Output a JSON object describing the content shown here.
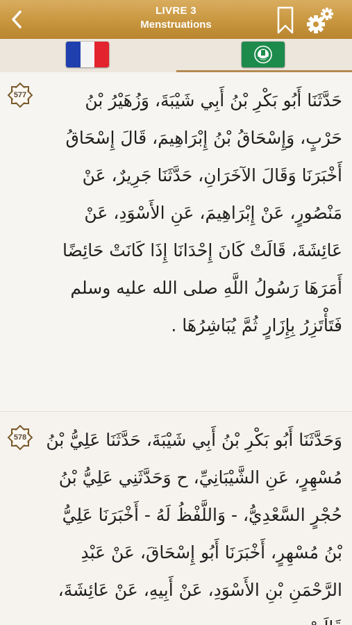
{
  "header": {
    "book": "LIVRE 3",
    "chapter": "Menstruations",
    "icons": {
      "back": "chevron-left-icon",
      "bookmark": "bookmark-icon",
      "settings": "gear-icon"
    }
  },
  "languages": {
    "tabs": [
      {
        "name": "french",
        "flag": "france-flag-icon",
        "active": false
      },
      {
        "name": "arabic",
        "flag": "arab-league-flag-icon",
        "active": true
      }
    ]
  },
  "colors": {
    "header_gold": "#c8963f",
    "tab_underline": "#b58a52",
    "badge_border": "#7a5a2c"
  },
  "hadiths": [
    {
      "number": "577",
      "text": "حَدَّثَنَا أَبُو بَكْرِ بْنُ أَبِي شَيْبَةَ، وَزُهَيْرُ بْنُ حَرْبٍ، وَإِسْحَاقُ بْنُ إِبْرَاهِيمَ، قَالَ إِسْحَاقُ أَخْبَرَنَا وَقَالَ الآخَرَانِ، حَدَّثَنَا جَرِيرٌ، عَنْ مَنْصُورٍ، عَنْ إِبْرَاهِيمَ، عَنِ الأَسْوَدِ، عَنْ عَائِشَةَ، قَالَتْ كَانَ إِحْدَانَا إِذَا كَانَتْ حَائِضًا أَمَرَهَا رَسُولُ اللَّهِ صلى الله عليه وسلم فَتَأْتَزِرُ بِإِزَارٍ ثُمَّ يُبَاشِرُهَا ."
    },
    {
      "number": "578",
      "text": "وَحَدَّثَنَا أَبُو بَكْرِ بْنُ أَبِي شَيْبَةَ، حَدَّثَنَا عَلِيُّ بْنُ مُسْهِرٍ، عَنِ الشَّيْبَانِيِّ، ح وَحَدَّثَنِي عَلِيُّ بْنُ حُجْرٍ السَّعْدِيُّ، - وَاللَّفْظُ لَهُ - أَخْبَرَنَا عَلِيُّ بْنُ مُسْهِرٍ، أَخْبَرَنَا أَبُو إِسْحَاقَ، عَنْ عَبْدِ الرَّحْمَنِ بْنِ الأَسْوَدِ، عَنْ أَبِيهِ، عَنْ عَائِشَةَ، قَالَتْ"
    }
  ]
}
